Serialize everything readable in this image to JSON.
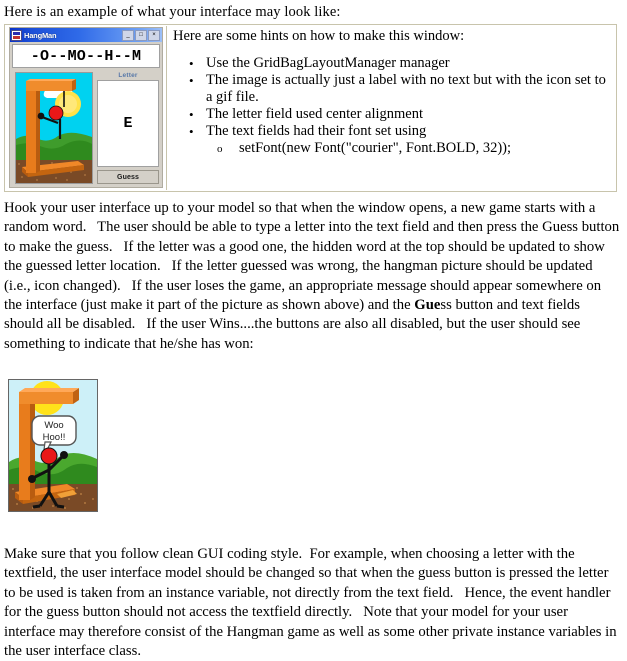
{
  "document": {
    "intro_line": "Here is an example of what your interface may look like:",
    "paragraph_1": "Hook your user interface up to your model so that when the window opens, a new game starts with a random word.   The user should be able to type a letter into the text field and then press the Guess button to make the guess.   If the letter was a good one, the hidden word at the top should be updated to show the guessed letter location.   If the letter guessed was wrong, the hangman picture should be updated (i.e., icon changed).   If the user loses the game, an appropriate message should appear somewhere on the interface (just make it part of the picture as shown above) and the ",
    "paragraph_2_bold": "Gue",
    "paragraph_2_bold_tail": "ss",
    "paragraph_2_rest": " button and text fields should all be disabled.   If the user Wins....the buttons are also all disabled, but the user should see something to indicate that he/she has won:",
    "paragraph_3": "Make sure that you follow clean GUI coding style.  For example, when choosing a letter with the textfield, the user interface model should be changed so that when the guess button is pressed the letter to be used is taken from an instance variable, not directly from the text field.   Hence, the event handler for the guess button should not access the textfield directly.   Note that your model for your user interface may therefore consist of the Hangman game as well as some other private instance variables in the user interface class."
  },
  "app_window": {
    "title": "HangMan",
    "minimize_label": "_",
    "maximize_label": "□",
    "close_label": "×",
    "word_display": "-O--MO--H--M",
    "letter_label": "Letter",
    "letter_value": "E",
    "guess_button": "Guess"
  },
  "hints_panel": {
    "title": "Here are some hints on how to make this window:",
    "items": [
      "Use the GridBagLayoutManager manager",
      "The image is actually just a label with no text but with the icon set to a gif file.",
      "The letter field used center alignment",
      "The text fields had their font set using"
    ],
    "sub_item": "setFont(new Font(\"courier\", Font.BOLD, 32));",
    "bullet_glyph": "•",
    "sub_bullet_glyph": "o"
  },
  "win_picture": {
    "speech_line_1": "Woo",
    "speech_line_2": "Hoo!!"
  },
  "colors": {
    "titlebar_blue": "#2f6ae8",
    "sky": "#00d2f0",
    "win_sky": "#cdf0f8",
    "grass": "#3a9a28",
    "dirt": "#7a4a26",
    "wood": "#e07818",
    "head_red": "#e81818",
    "sun_yellow": "#ffe848",
    "box_border": "#c8c4ac",
    "label_blue": "#5878a8"
  }
}
